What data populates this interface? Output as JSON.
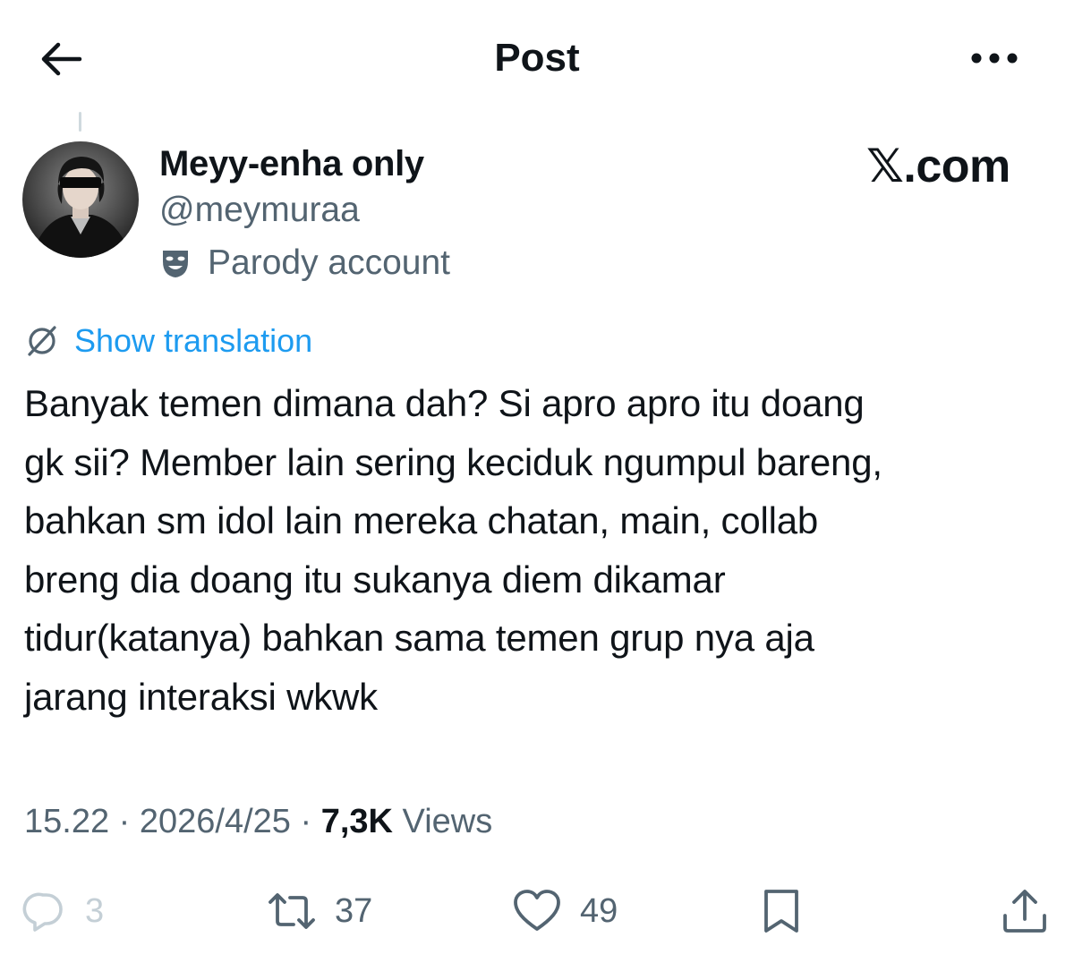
{
  "header": {
    "title": "Post"
  },
  "author": {
    "display_name": "Meyy-enha only",
    "handle": "@meymuraa",
    "parody_label": "Parody account",
    "brand": "𝕏.com"
  },
  "translation": {
    "label": "Show translation"
  },
  "post": {
    "text": "Banyak temen dimana dah? Si apro apro itu doang\ngk sii? Member lain sering keciduk ngumpul bareng,\nbahkan sm idol lain mereka chatan, main, collab\nbreng dia doang itu sukanya diem dikamar\ntidur(katanya) bahkan sama temen grup nya aja\njarang interaksi wkwk"
  },
  "meta": {
    "time": "15.22",
    "separator": " · ",
    "date": "2026/4/25",
    "views_count": "7,3K",
    "views_label": " Views"
  },
  "actions": {
    "reply_count": "3",
    "retweet_count": "37",
    "like_count": "49"
  },
  "icons": {
    "back": "arrow-left-icon",
    "more": "more-dots-icon",
    "parody": "theater-mask-icon",
    "translate": "globe-icon",
    "reply": "speech-bubble-icon",
    "retweet": "retweet-icon",
    "like": "heart-icon",
    "bookmark": "bookmark-icon",
    "share": "share-icon"
  },
  "colors": {
    "text": "#0f1419",
    "secondary": "#536471",
    "link": "#1d9bf0",
    "disabled": "#c4cfd6"
  }
}
